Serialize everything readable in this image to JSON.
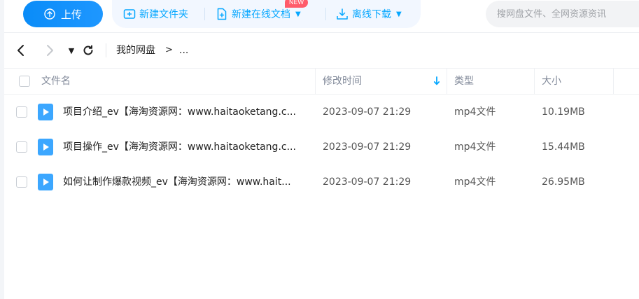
{
  "toolbar": {
    "upload_label": "上传",
    "new_folder_label": "新建文件夹",
    "new_online_doc_label": "新建在线文档",
    "new_badge": "NEW",
    "offline_download_label": "离线下载",
    "search_placeholder": "搜网盘文件、全网资源资讯",
    "accent_color": "#06a7ff"
  },
  "nav": {
    "breadcrumb": [
      "我的网盘",
      ">",
      "..."
    ]
  },
  "table": {
    "columns": [
      "文件名",
      "修改时间",
      "类型",
      "大小"
    ],
    "sort_column": "修改时间",
    "rows": [
      {
        "name": "项目介绍_ev【海淘资源网：www.haitaoketang.c...",
        "time": "2023-09-07 21:29",
        "type": "mp4文件",
        "size": "10.19MB",
        "icon": "video-file-icon"
      },
      {
        "name": "项目操作_ev【海淘资源网：www.haitaoketang.c...",
        "time": "2023-09-07 21:29",
        "type": "mp4文件",
        "size": "15.44MB",
        "icon": "video-file-icon"
      },
      {
        "name": "如何让制作爆款视频_ev【海淘资源网：www.hait...",
        "time": "2023-09-07 21:29",
        "type": "mp4文件",
        "size": "26.95MB",
        "icon": "video-file-icon"
      }
    ]
  }
}
